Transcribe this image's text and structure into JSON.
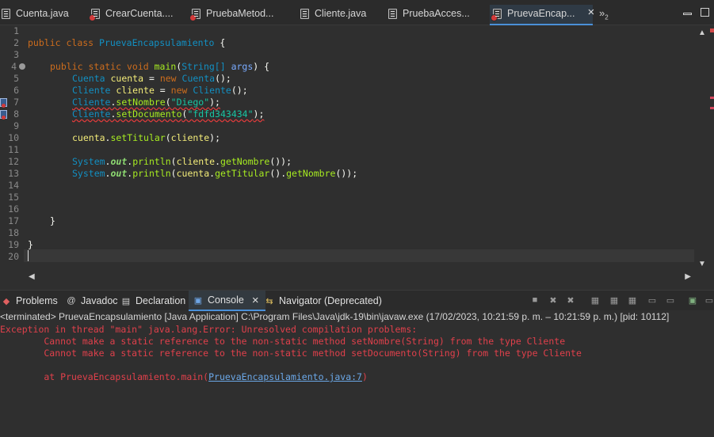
{
  "editor_tabs": [
    {
      "label": "Cuenta.java",
      "icon": "java-file-icon",
      "error": false,
      "active": false
    },
    {
      "label": "CrearCuenta....",
      "icon": "java-file-error-icon",
      "error": true,
      "active": false
    },
    {
      "label": "PruebaMetod...",
      "icon": "java-file-error-icon",
      "error": true,
      "active": false
    },
    {
      "label": "Cliente.java",
      "icon": "java-file-icon",
      "error": false,
      "active": false
    },
    {
      "label": "PruebaAcces...",
      "icon": "java-file-icon",
      "error": false,
      "active": false
    },
    {
      "label": "PruevaEncap...",
      "icon": "java-file-error-icon",
      "error": true,
      "active": true
    }
  ],
  "tab_overflow": {
    "symbol": "»",
    "count": "2"
  },
  "line_numbers": [
    "1",
    "2",
    "3",
    "4",
    "5",
    "6",
    "7",
    "8",
    "9",
    "10",
    "11",
    "12",
    "13",
    "14",
    "15",
    "16",
    "17",
    "18",
    "19",
    "20"
  ],
  "code": {
    "class_decl": {
      "kw1": "public",
      "kw2": "class",
      "name": "PruevaEncapsulamiento",
      "brace": "{"
    },
    "main_decl": {
      "kw1": "public",
      "kw2": "static",
      "kw3": "void",
      "name": "main",
      "open": "(",
      "ptype": "String[]",
      "pname": "args",
      "close": ") {"
    },
    "line5": {
      "type": "Cuenta",
      "var": "cuenta",
      "eq": " = ",
      "kw": "new",
      "ctor": "Cuenta",
      "end": "();"
    },
    "line6": {
      "type": "Cliente",
      "var": "cliente",
      "eq": " = ",
      "kw": "new",
      "ctor": "Cliente",
      "end": "();"
    },
    "line7": {
      "target": "Cliente",
      "dot": ".",
      "method": "setNombre",
      "open": "(",
      "arg": "\"Diego\"",
      "end": ");"
    },
    "line8": {
      "target": "Cliente",
      "dot": ".",
      "method": "setDocumento",
      "open": "(",
      "arg": "\"fdfd343434\"",
      "end": ");"
    },
    "line10": {
      "target": "cuenta",
      "dot": ".",
      "method": "setTitular",
      "open": "(",
      "arg": "cliente",
      "end": ");"
    },
    "line12": {
      "sys": "System",
      "d1": ".",
      "out": "out",
      "d2": ".",
      "m": "println",
      "o": "(",
      "a": "cliente",
      "d3": ".",
      "g": "getNombre",
      "e": "());"
    },
    "line13": {
      "sys": "System",
      "d1": ".",
      "out": "out",
      "d2": ".",
      "m": "println",
      "o": "(",
      "a": "cuenta",
      "d3": ".",
      "g1": "getTitular",
      "mid": "().",
      "g2": "getNombre",
      "e": "());"
    },
    "line17": "}",
    "line19": "}"
  },
  "panel_tabs": [
    {
      "label": "Problems",
      "icon": "problems-icon",
      "active": false
    },
    {
      "label": "Javadoc",
      "icon": "javadoc-icon",
      "active": false
    },
    {
      "label": "Declaration",
      "icon": "declaration-icon",
      "active": false
    },
    {
      "label": "Console",
      "icon": "console-icon",
      "active": true
    },
    {
      "label": "Navigator (Deprecated)",
      "icon": "navigator-icon",
      "active": false
    }
  ],
  "console": {
    "status": "<terminated> PruevaEncapsulamiento [Java Application] C:\\Program Files\\Java\\jdk-19\\bin\\javaw.exe  (17/02/2023, 10:21:59 p. m. – 10:21:59 p. m.) [pid: 10112]",
    "line1": "Exception in thread \"main\" java.lang.Error: Unresolved compilation problems: ",
    "line2": "        Cannot make a static reference to the non-static method setNombre(String) from the type Cliente",
    "line3": "        Cannot make a static reference to the non-static method setDocumento(String) from the type Cliente",
    "line4_prefix": "        at PruevaEncapsulamiento.main(",
    "line4_link": "PruevaEncapsulamiento.java:7",
    "line4_suffix": ")"
  },
  "colors": {
    "background": "#2f2f2f",
    "keyword": "#cc6c1d",
    "type": "#1290c3",
    "method": "#a7ec21",
    "string": "#17c6a3",
    "error_text": "#e0404b",
    "link": "#6ba8e8"
  }
}
